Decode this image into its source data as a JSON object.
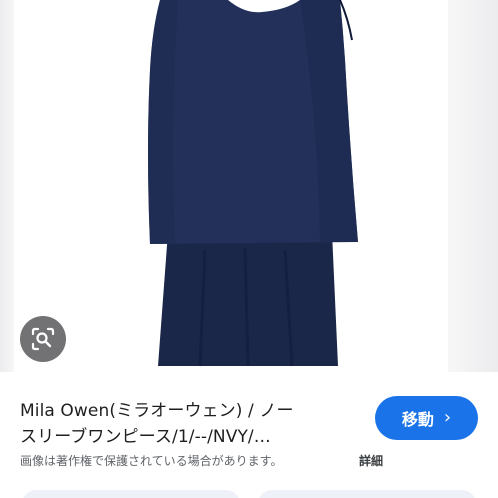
{
  "result": {
    "title_line1": "Mila Owen(ミラオーウェン) / ノー",
    "title_line2": "スリーブワンピース/1/--/NVY/…",
    "notice": "画像は著作権で保護されている場合があります。",
    "details_label": "詳細"
  },
  "actions": {
    "visit_label": "移動",
    "visit_chevron": "›"
  },
  "icons": {
    "lens": "lens-search-icon"
  },
  "colors": {
    "accent": "#1a73e8",
    "dress": "#1f2d55",
    "lens_bg": "#3c3c40"
  }
}
